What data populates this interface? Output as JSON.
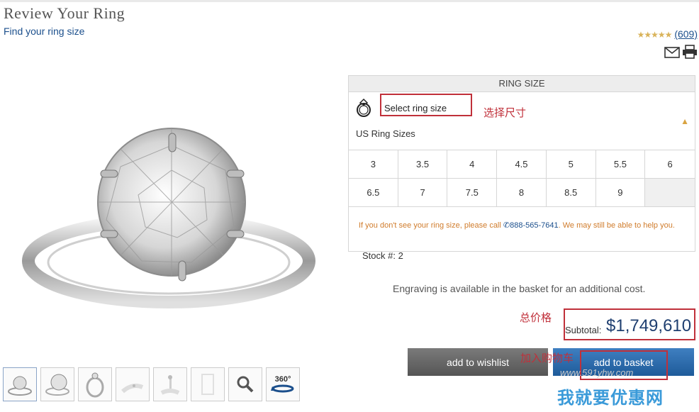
{
  "page": {
    "title": "Review Your Ring",
    "subtitle": "Find your ring size"
  },
  "rating": {
    "stars": "★★★★★",
    "count": "(609)"
  },
  "icons": {
    "email": "email-icon",
    "print": "print-icon",
    "ring": "ring-icon",
    "search": "search-icon",
    "rotate": "rotate-360-icon"
  },
  "ring_size": {
    "header": "RING SIZE",
    "select_placeholder": "Select ring size",
    "annotation": "选择尺寸",
    "us_label": "US Ring Sizes",
    "sizes": [
      "3",
      "3.5",
      "4",
      "4.5",
      "5",
      "5.5",
      "6",
      "6.5",
      "7",
      "7.5",
      "8",
      "8.5",
      "9"
    ],
    "help_prefix": "If you don't see your ring size, please call ",
    "help_phone": "888-565-7641",
    "help_suffix": ". We may still be able to help you."
  },
  "thumbnails": {
    "rotate_label": "360°"
  },
  "stock": "Stock #: 2",
  "engraving": "Engraving is available in the basket for an additional cost.",
  "price": {
    "annotation": "总价格",
    "label": "Subtotal:",
    "value": "$1,749,610"
  },
  "buttons": {
    "wishlist": "add to wishlist",
    "basket": "add to basket",
    "basket_annotation": "加入购物车"
  },
  "watermark": {
    "text": "我就要优惠网",
    "url": "www.591yhw.com"
  },
  "colors": {
    "accent": "#1b4f8c",
    "annotation": "#c0303a",
    "help_text": "#d07c2c",
    "star": "#d9b35a"
  }
}
